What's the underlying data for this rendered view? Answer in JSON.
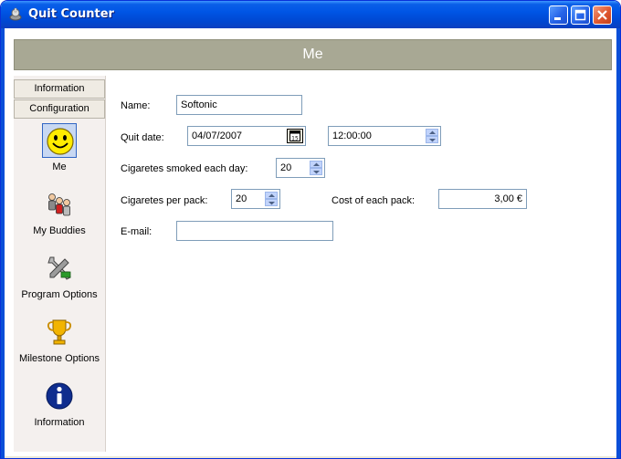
{
  "window": {
    "title": "Quit Counter"
  },
  "header": {
    "title": "Me"
  },
  "sidebar": {
    "tabs": [
      {
        "label": "Information"
      },
      {
        "label": "Configuration"
      }
    ],
    "items": [
      {
        "label": "Me",
        "icon": "smiley-icon",
        "selected": true
      },
      {
        "label": "My Buddies",
        "icon": "buddies-icon"
      },
      {
        "label": "Program Options",
        "icon": "tools-icon"
      },
      {
        "label": "Milestone Options",
        "icon": "trophy-icon"
      },
      {
        "label": "Information",
        "icon": "info-icon"
      }
    ]
  },
  "form": {
    "name_label": "Name:",
    "name_value": "Softonic",
    "quit_date_label": "Quit date:",
    "quit_date_value": "04/07/2007",
    "quit_time_value": "12:00:00",
    "cigs_per_day_label": "Cigaretes smoked each day:",
    "cigs_per_day_value": "20",
    "cigs_per_pack_label": "Cigaretes per pack:",
    "cigs_per_pack_value": "20",
    "pack_cost_label": "Cost of each pack:",
    "pack_cost_value": "3,00 €",
    "email_label": "E-mail:",
    "email_value": ""
  },
  "colors": {
    "titlebar": "#0055e5",
    "header_bar": "#a8a894",
    "selected_bg": "#c8d8f2",
    "close_button": "#e0572f"
  }
}
